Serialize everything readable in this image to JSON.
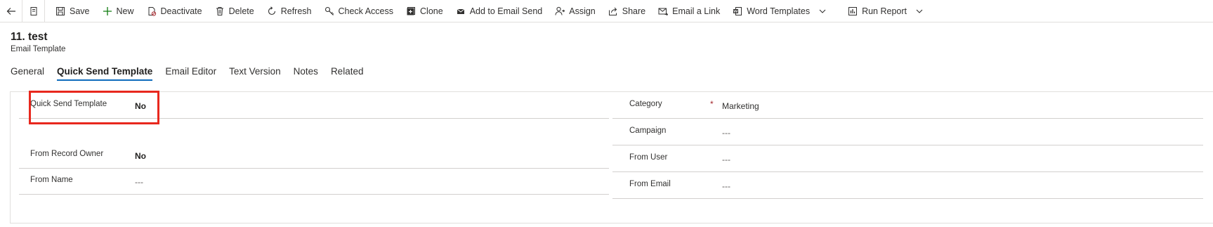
{
  "command_bar": {
    "items": [
      {
        "label": "Save",
        "icon": "save-icon"
      },
      {
        "label": "New",
        "icon": "plus-icon"
      },
      {
        "label": "Deactivate",
        "icon": "deactivate-icon"
      },
      {
        "label": "Delete",
        "icon": "trash-icon"
      },
      {
        "label": "Refresh",
        "icon": "refresh-icon"
      },
      {
        "label": "Check Access",
        "icon": "key-icon"
      },
      {
        "label": "Clone",
        "icon": "clone-icon"
      },
      {
        "label": "Add to Email Send",
        "icon": "email-icon"
      },
      {
        "label": "Assign",
        "icon": "assign-icon"
      },
      {
        "label": "Share",
        "icon": "share-icon"
      },
      {
        "label": "Email a Link",
        "icon": "mail-link-icon"
      },
      {
        "label": "Word Templates",
        "icon": "word-icon"
      },
      {
        "label": "Run Report",
        "icon": "report-icon"
      }
    ]
  },
  "record": {
    "title": "11. test",
    "entity": "Email Template"
  },
  "tabs": [
    {
      "label": "General"
    },
    {
      "label": "Quick Send Template"
    },
    {
      "label": "Email Editor"
    },
    {
      "label": "Text Version"
    },
    {
      "label": "Notes"
    },
    {
      "label": "Related"
    }
  ],
  "form": {
    "left": [
      {
        "label": "Quick Send Template",
        "value": "No"
      },
      {
        "label": "From Record Owner",
        "value": "No"
      },
      {
        "label": "From Name",
        "value": "---"
      }
    ],
    "right": [
      {
        "label": "Category",
        "value": "Marketing",
        "required_marker": "*"
      },
      {
        "label": "Campaign",
        "value": "---"
      },
      {
        "label": "From User",
        "value": "---"
      },
      {
        "label": "From Email",
        "value": "---"
      }
    ]
  },
  "colors": {
    "accent": "#0f6cbd",
    "highlight": "#e8281e",
    "required": "#a4262c",
    "border": "#e1dfdd"
  }
}
